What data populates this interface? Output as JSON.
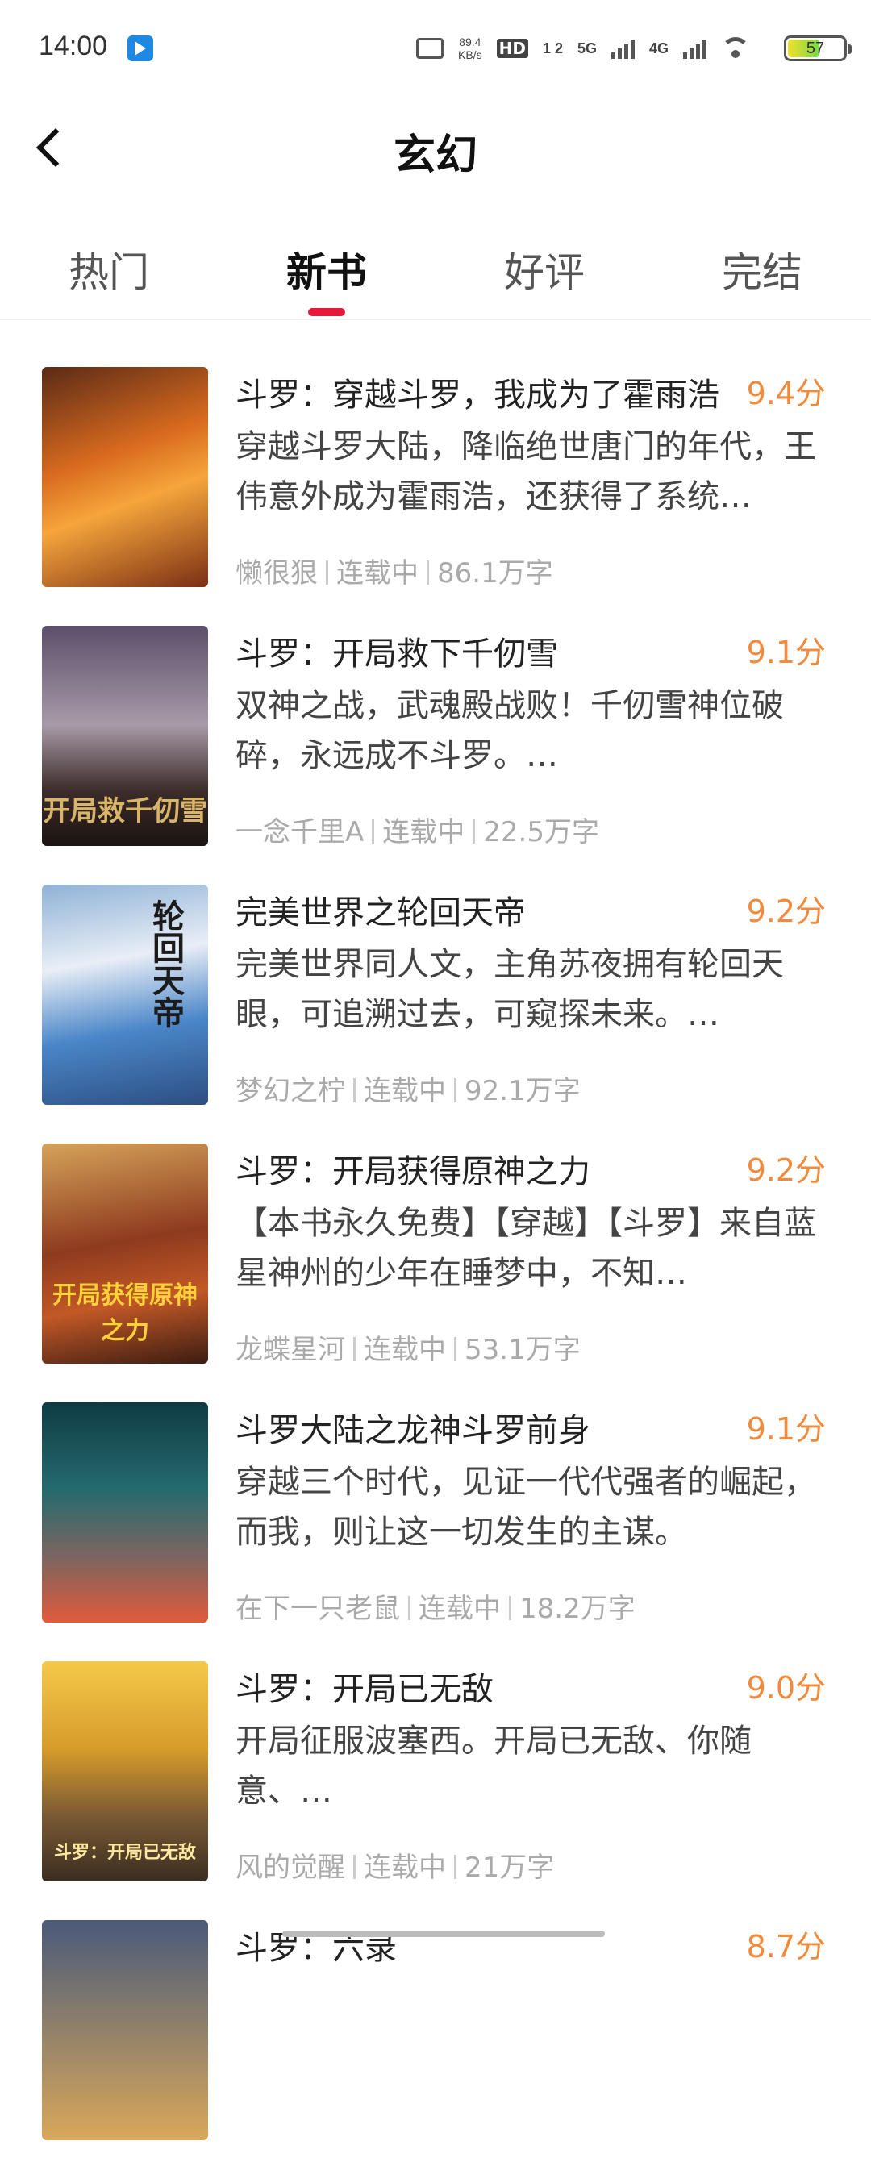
{
  "status_bar": {
    "time": "14:00",
    "net_speed_value": "89.4",
    "net_speed_unit": "KB/s",
    "hd_label": "HD",
    "hd_sub": "1 2",
    "net1": "5G",
    "net2": "4G",
    "battery": "57",
    "battery_level": 0.57
  },
  "header": {
    "title": "玄幻",
    "back_icon": "chevron-left-icon"
  },
  "tabs": [
    {
      "label": "热门",
      "active": false
    },
    {
      "label": "新书",
      "active": true
    },
    {
      "label": "好评",
      "active": false
    },
    {
      "label": "完结",
      "active": false
    }
  ],
  "accent_color": "#e8183a",
  "score_color": "#f08a3c",
  "books": [
    {
      "title": "斗罗：穿越斗罗，我成为了霍雨浩",
      "score": "9.4分",
      "desc": "穿越斗罗大陆，降临绝世唐门的年代，王伟意外成为霍雨浩，还获得了系统…",
      "author": "懒很狠",
      "status": "连载中",
      "words": "86.1万字"
    },
    {
      "title": "斗罗：开局救下千仞雪",
      "score": "9.1分",
      "desc": "双神之战，武魂殿战败！千仞雪神位破碎，永远成不斗罗。…",
      "author": "一念千里A",
      "status": "连载中",
      "words": "22.5万字",
      "cover_text": "开局救千仞雪"
    },
    {
      "title": "完美世界之轮回天帝",
      "score": "9.2分",
      "desc": "完美世界同人文，主角苏夜拥有轮回天眼，可追溯过去，可窥探未来。…",
      "author": "梦幻之柠",
      "status": "连载中",
      "words": "92.1万字",
      "cover_text": "轮回天帝"
    },
    {
      "title": "斗罗：开局获得原神之力",
      "score": "9.2分",
      "desc": "【本书永久免费】【穿越】【斗罗】来自蓝星神州的少年在睡梦中，不知…",
      "author": "龙蝶星河",
      "status": "连载中",
      "words": "53.1万字",
      "cover_text": "开局获得原神之力"
    },
    {
      "title": "斗罗大陆之龙神斗罗前身",
      "score": "9.1分",
      "desc": "穿越三个时代，见证一代代强者的崛起，而我，则让这一切发生的主谋。",
      "author": "在下一只老鼠",
      "status": "连载中",
      "words": "18.2万字"
    },
    {
      "title": "斗罗：开局已无敌",
      "score": "9.0分",
      "desc": "开局征服波塞西。开局已无敌、你随意、…",
      "author": "风的觉醒",
      "status": "连载中",
      "words": "21万字",
      "cover_text": "斗罗：开局已无敌"
    }
  ],
  "partial_book": {
    "title": "斗罗：六录",
    "score": "8.7分"
  }
}
